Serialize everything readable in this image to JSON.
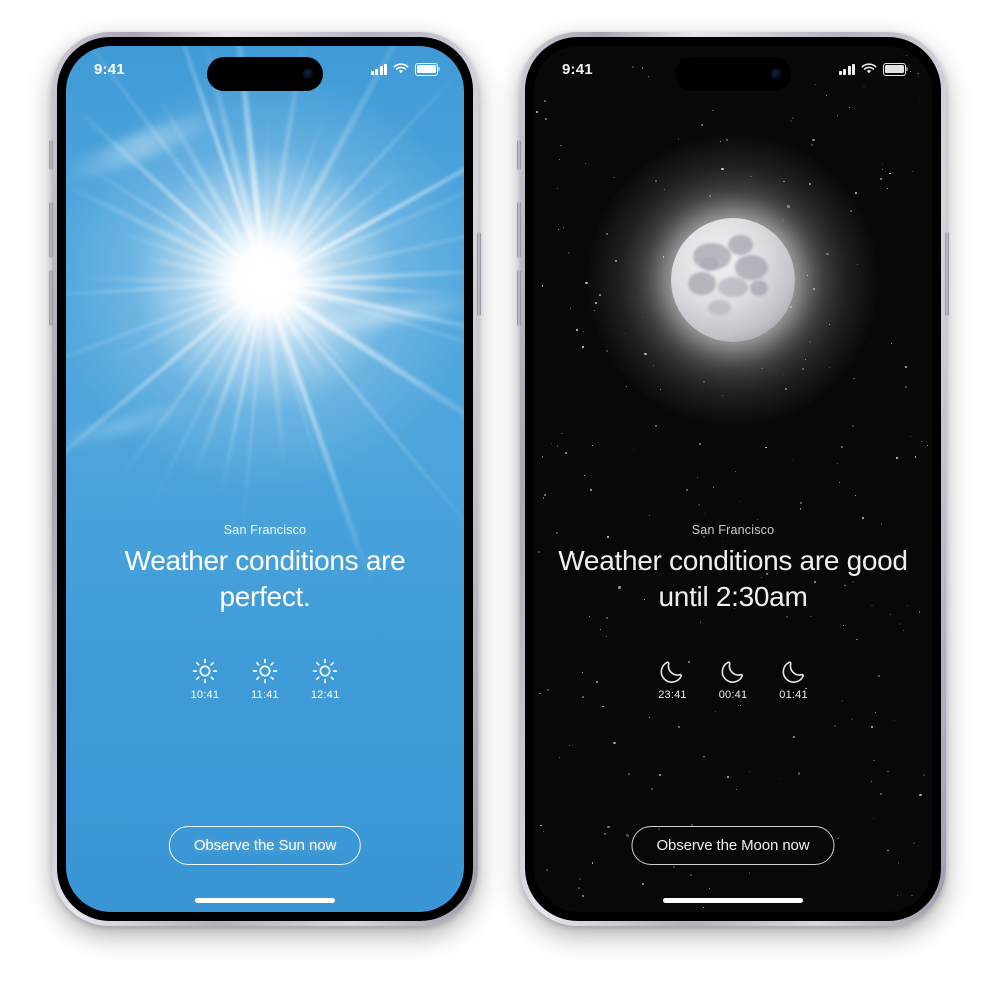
{
  "screens": [
    {
      "id": "sun-screen",
      "theme": "light",
      "statusbar": {
        "time": "9:41",
        "signal_icon": "cellular-signal-icon",
        "wifi_icon": "wifi-icon",
        "battery_icon": "battery-icon"
      },
      "city": "San Francisco",
      "headline": "Weather conditions are perfect.",
      "forecast": [
        {
          "icon": "sun-icon",
          "time": "10:41"
        },
        {
          "icon": "sun-icon",
          "time": "11:41"
        },
        {
          "icon": "sun-icon",
          "time": "12:41"
        }
      ],
      "cta": "Observe the Sun now",
      "hero_icon": "sun-burst-image",
      "colors": {
        "sky_top": "#3f9ad6",
        "sky_mid": "#51a7dd",
        "sky_bottom": "#3a95d4",
        "text": "#ffffff"
      }
    },
    {
      "id": "moon-screen",
      "theme": "dark",
      "statusbar": {
        "time": "9:41",
        "signal_icon": "cellular-signal-icon",
        "wifi_icon": "wifi-icon",
        "battery_icon": "battery-icon"
      },
      "city": "San Francisco",
      "headline": "Weather conditions are good until 2:30am",
      "forecast": [
        {
          "icon": "crescent-moon-icon",
          "time": "23:41"
        },
        {
          "icon": "crescent-moon-icon",
          "time": "00:41"
        },
        {
          "icon": "crescent-moon-icon",
          "time": "01:41"
        }
      ],
      "cta": "Observe the Moon now",
      "hero_icon": "full-moon-image",
      "colors": {
        "background": "#080808",
        "text": "#efefef",
        "moon": "#dedee2"
      }
    }
  ]
}
